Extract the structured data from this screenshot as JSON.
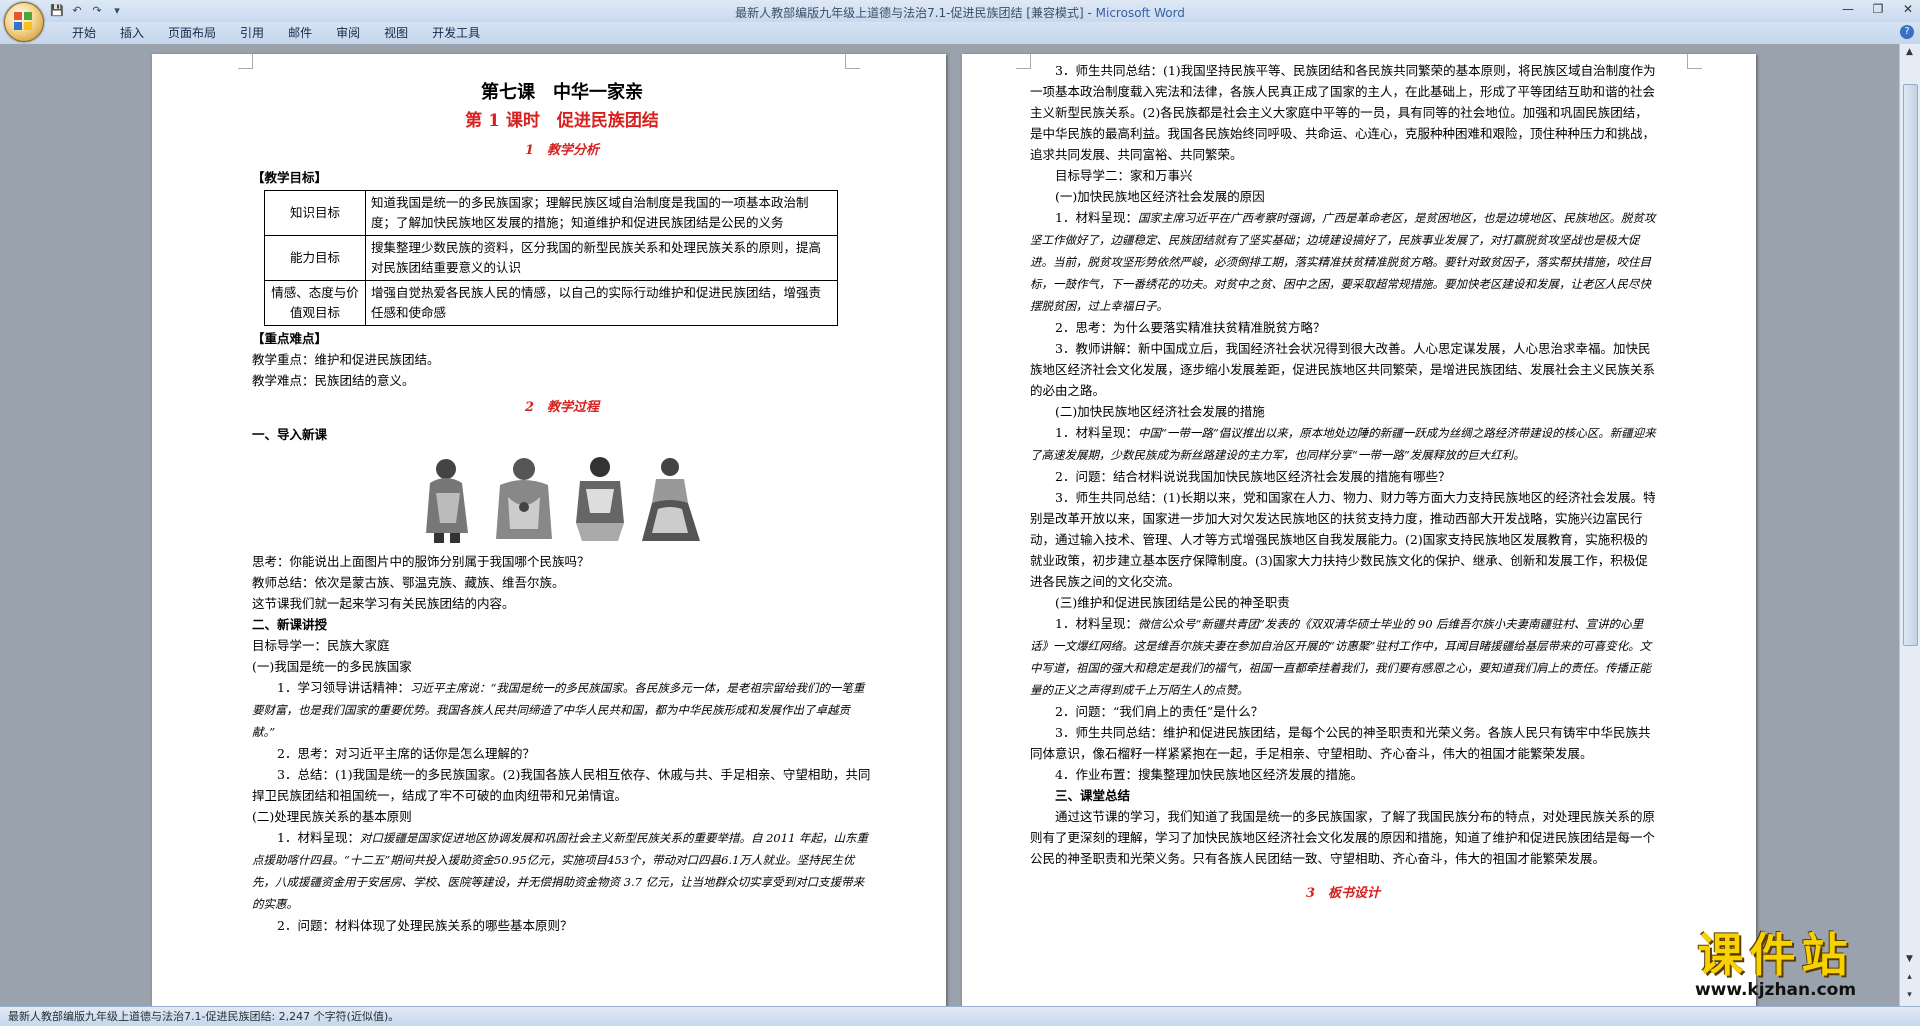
{
  "window": {
    "title": "最新人教部编版九年级上道德与法治7.1-促进民族团结 [兼容模式] - ",
    "app_name": "Microsoft Word"
  },
  "quick_access": {
    "save": "save-icon",
    "undo": "undo-icon",
    "redo": "redo-icon",
    "customize": "dropdown-icon"
  },
  "ribbon_tabs": [
    "开始",
    "插入",
    "页面布局",
    "引用",
    "邮件",
    "审阅",
    "视图",
    "开发工具"
  ],
  "left_page": {
    "lesson_title": "第七课　中华一家亲",
    "lesson_subtitle": "第 1 课时　促进民族团结",
    "section1": "1　教学分析",
    "goals_heading": "【教学目标】",
    "goals": [
      {
        "key": "知识目标",
        "text": "知道我国是统一的多民族国家；理解民族区域自治制度是我国的一项基本政治制度；了解加快民族地区发展的措施；知道维护和促进民族团结是公民的义务"
      },
      {
        "key": "能力目标",
        "text": "搜集整理少数民族的资料，区分我国的新型民族关系和处理民族关系的原则，提高对民族团结重要意义的认识"
      },
      {
        "key": "情感、态度与价值观目标",
        "text": "增强自觉热爱各民族人民的情感，以自己的实际行动维护和促进民族团结，增强责任感和使命感"
      }
    ],
    "difficulty_heading": "【重点难点】",
    "key_point": "教学重点：维护和促进民族团结。",
    "hard_point": "教学难点：民族团结的意义。",
    "section2": "2　教学过程",
    "part1": "一、导入新课",
    "think1": "思考：你能说出上面图片中的服饰分别属于我国哪个民族吗？",
    "teacher_sum1": "教师总结：依次是蒙古族、鄂温克族、藏族、维吾尔族。",
    "intro_line": "这节课我们就一起来学习有关民族团结的内容。",
    "part2": "二、新课讲授",
    "guide1": "目标导学一：民族大家庭",
    "sub1": "(一)我国是统一的多民族国家",
    "item1": "1．学习领导讲话精神：",
    "item1_quote": "习近平主席说：“我国是统一的多民族国家。各民族多元一体，是老祖宗留给我们的一笔重要财富，也是我们国家的重要优势。我国各族人民共同缔造了中华人民共和国，都为中华民族形成和发展作出了卓越贡献。”",
    "item2": "2．思考：对习近平主席的话你是怎么理解的？",
    "item3": "3．总结：(1)我国是统一的多民族国家。(2)我国各族人民相互依存、休戚与共、手足相亲、守望相助，共同捍卫民族团结和祖国统一，结成了牢不可破的血肉纽带和兄弟情谊。",
    "sub2": "(二)处理民族关系的基本原则",
    "item4": "1．材料呈现：",
    "item4_quote": "对口援疆是国家促进地区协调发展和巩固社会主义新型民族关系的重要举措。自 2011 年起，山东重点援助喀什四县。“十二五”期间共投入援助资金50.95亿元，实施项目453个，带动对口四县6.1万人就业。坚持民生优先，八成援疆资金用于安居房、学校、医院等建设，并无偿捐助资金物资 3.7 亿元，让当地群众切实享受到对口支援带来的实惠。",
    "item5": "2．问题：材料体现了处理民族关系的哪些基本原则？"
  },
  "right_page": {
    "r1": "3．师生共同总结：(1)我国坚持民族平等、民族团结和各民族共同繁荣的基本原则，将民族区域自治制度作为一项基本政治制度载入宪法和法律，各族人民真正成了国家的主人，在此基础上，形成了平等团结互助和谐的社会主义新型民族关系。(2)各民族都是社会主义大家庭中平等的一员，具有同等的社会地位。加强和巩固民族团结，是中华民族的最高利益。我国各民族始终同呼吸、共命运、心连心，克服种种困难和艰险，顶住种种压力和挑战，追求共同发展、共同富裕、共同繁荣。",
    "guide2": "目标导学二：家和万事兴",
    "sub1": "(一)加快民族地区经济社会发展的原因",
    "m1": "1．材料呈现：",
    "m1_quote": "国家主席习近平在广西考察时强调，广西是革命老区，是贫困地区，也是边境地区、民族地区。脱贫攻坚工作做好了，边疆稳定、民族团结就有了坚实基础；边境建设搞好了，民族事业发展了，对打赢脱贫攻坚战也是极大促进。当前，脱贫攻坚形势依然严峻，必须倒排工期，落实精准扶贫精准脱贫方略。要针对致贫因子，落实帮扶措施，咬住目标，一鼓作气，下一番绣花的功夫。对贫中之贫、困中之困，要采取超常规措施。要加快老区建设和发展，让老区人民尽快摆脱贫困，过上幸福日子。",
    "m2": "2．思考：为什么要落实精准扶贫精准脱贫方略？",
    "m3": "3．教师讲解：新中国成立后，我国经济社会状况得到很大改善。人心思定谋发展，人心思治求幸福。加快民族地区经济社会文化发展，逐步缩小发展差距，促进民族地区共同繁荣，是增进民族团结、发展社会主义民族关系的必由之路。",
    "sub2": "(二)加快民族地区经济社会发展的措施",
    "n1": "1．材料呈现：",
    "n1_quote": "中国“一带一路”倡议推出以来，原本地处边陲的新疆一跃成为丝绸之路经济带建设的核心区。新疆迎来了高速发展期，少数民族成为新丝路建设的主力军，也同样分享“一带一路”发展释放的巨大红利。",
    "n2": "2．问题：结合材料说说我国加快民族地区经济社会发展的措施有哪些？",
    "n3": "3．师生共同总结：(1)长期以来，党和国家在人力、物力、财力等方面大力支持民族地区的经济社会发展。特别是改革开放以来，国家进一步加大对欠发达民族地区的扶贫支持力度，推动西部大开发战略，实施兴边富民行动，通过输入技术、管理、人才等方式增强民族地区自我发展能力。(2)国家支持民族地区发展教育，实施积极的就业政策，初步建立基本医疗保障制度。(3)国家大力扶持少数民族文化的保护、继承、创新和发展工作，积极促进各民族之间的文化交流。",
    "sub3": "(三)维护和促进民族团结是公民的神圣职责",
    "o1": "1．材料呈现：",
    "o1_quote": "微信公众号“新疆共青团”发表的《双双清华硕士毕业的 90 后维吾尔族小夫妻南疆驻村、宣讲的心里话》一文爆红网络。这是维吾尔族夫妻在参加自治区开展的“访惠聚”驻村工作中，耳闻目睹援疆给基层带来的可喜变化。文中写道，祖国的强大和稳定是我们的福气，祖国一直都牵挂着我们，我们要有感恩之心，要知道我们肩上的责任。传播正能量的正义之声得到成千上万陌生人的点赞。",
    "o2": "2．问题：“我们肩上的责任”是什么？",
    "o3": "3．师生共同总结：维护和促进民族团结，是每个公民的神圣职责和光荣义务。各族人民只有铸牢中华民族共同体意识，像石榴籽一样紧紧抱在一起，手足相亲、守望相助、齐心奋斗，伟大的祖国才能繁荣发展。",
    "o4": "4．作业布置：搜集整理加快民族地区经济发展的措施。",
    "part3": "三、课堂总结",
    "summary": "通过这节课的学习，我们知道了我国是统一的多民族国家，了解了我国民族分布的特点，对处理民族关系的原则有了更深刻的理解，学习了加快民族地区经济社会文化发展的原因和措施，知道了维护和促进民族团结是每一个公民的神圣职责和光荣义务。只有各族人民团结一致、守望相助、齐心奋斗，伟大的祖国才能繁荣发展。",
    "section3": "3　板书设计"
  },
  "status_bar": {
    "text": "最新人教部编版九年级上道德与法治7.1-促进民族团结: 2,247 个字符(近似值)。"
  },
  "watermark": {
    "big": "课件站",
    "url": "www.kjzhan.com"
  }
}
